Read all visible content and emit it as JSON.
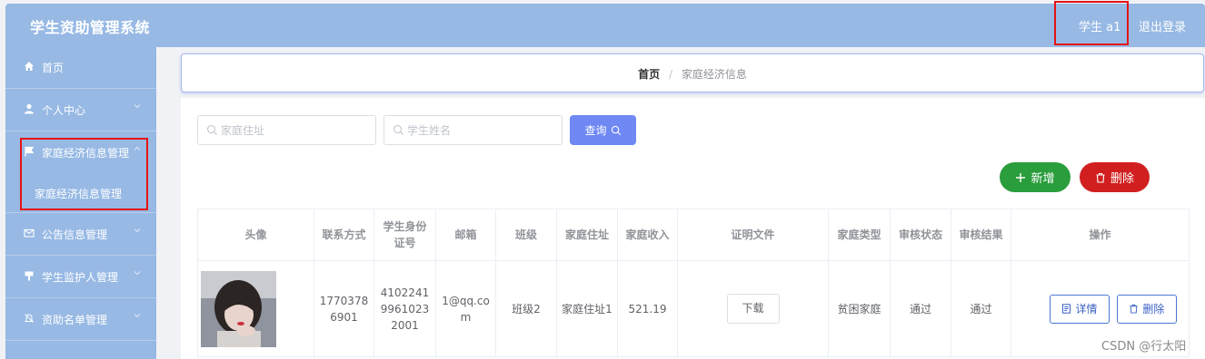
{
  "header": {
    "title": "学生资助管理系统",
    "user": "学生 a1",
    "logout": "退出登录"
  },
  "sidebar": {
    "items": [
      {
        "label": "首页"
      },
      {
        "label": "个人中心"
      },
      {
        "label": "家庭经济信息管理"
      },
      {
        "label": "公告信息管理"
      },
      {
        "label": "学生监护人管理"
      },
      {
        "label": "资助名单管理"
      }
    ],
    "sub_label": "家庭经济信息管理"
  },
  "breadcrumb": {
    "home": "首页",
    "separator": "/",
    "current": "家庭经济信息"
  },
  "search": {
    "address_placeholder": "家庭住址",
    "name_placeholder": "学生姓名",
    "query_label": "查询"
  },
  "actions": {
    "add_label": "新增",
    "delete_label": "删除"
  },
  "table": {
    "headers": [
      "头像",
      "联系方式",
      "学生身份证号",
      "邮箱",
      "班级",
      "家庭住址",
      "家庭收入",
      "证明文件",
      "家庭类型",
      "审核状态",
      "审核结果",
      "操作"
    ],
    "rows": [
      {
        "contact": "17703786901",
        "id_number": "410224199610232001",
        "email": "1@qq.com",
        "class": "班级2",
        "address": "家庭住址1",
        "income": "521.19",
        "file_button": "下载",
        "family_type": "贫困家庭",
        "review_status": "通过",
        "review_result": "通过",
        "detail_label": "详情",
        "delete_label": "删除"
      }
    ]
  },
  "watermark": "CSDN @行太阳",
  "colors": {
    "header_bg": "#97b9e4",
    "primary": "#6f88f4",
    "success": "#2a9d3c",
    "danger": "#d11f1f",
    "highlight_border": "#e41313"
  }
}
